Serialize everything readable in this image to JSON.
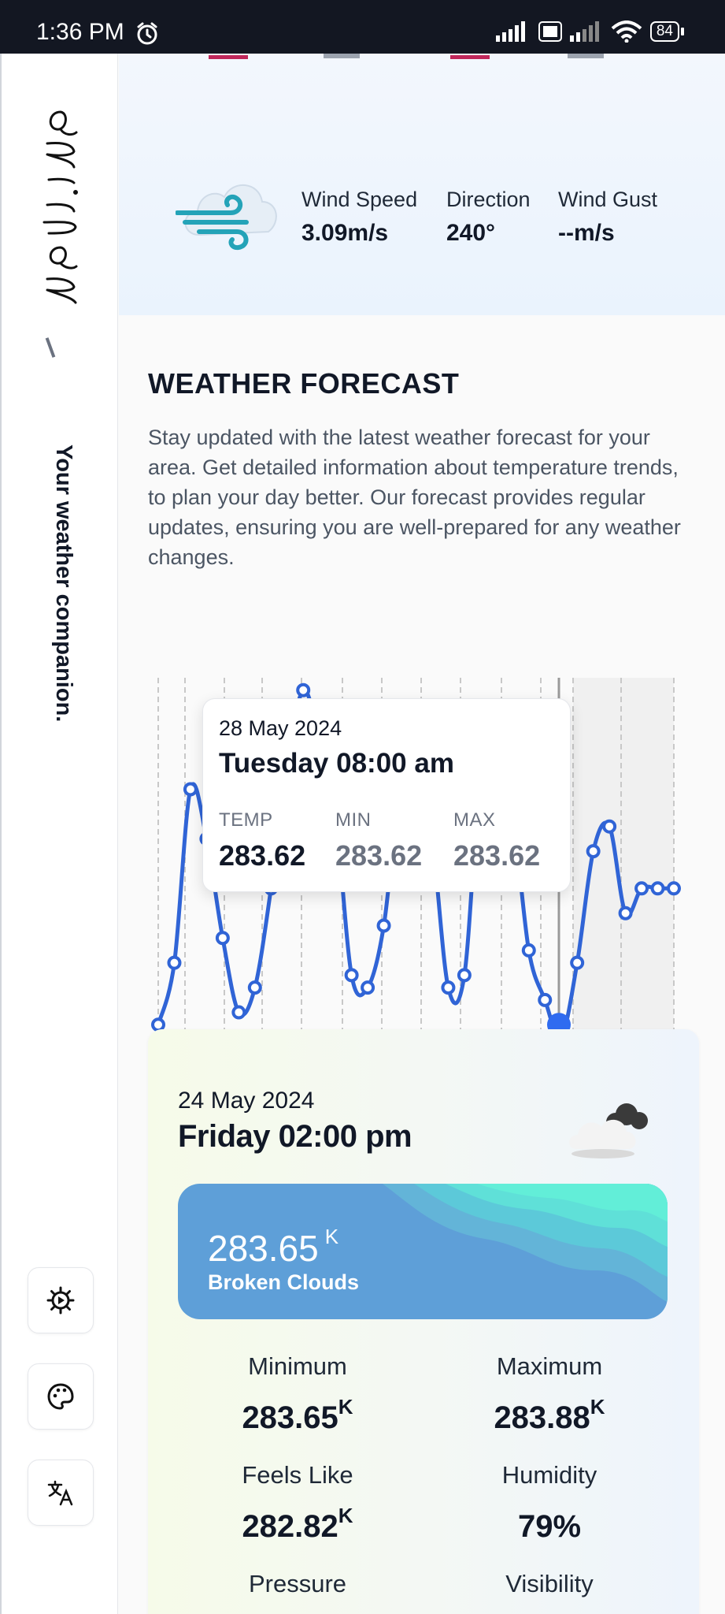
{
  "status_bar": {
    "time": "1:36 PM",
    "battery": "84"
  },
  "sidebar": {
    "tagline": "Your weather companion."
  },
  "wind": {
    "items": [
      {
        "label": "Wind Speed",
        "value": "3.09m/s"
      },
      {
        "label": "Direction",
        "value": "240°"
      },
      {
        "label": "Wind Gust",
        "value": "--m/s"
      }
    ]
  },
  "forecast": {
    "title": "WEATHER FORECAST",
    "description": "Stay updated with the latest weather forecast for your area. Get detailed information about temperature trends, to plan your day better. Our forecast provides regular updates, ensuring you are well-prepared for any weather changes."
  },
  "tooltip": {
    "date": "28 May 2024",
    "day_time": "Tuesday 08:00 am",
    "labels": {
      "temp": "TEMP",
      "min": "MIN",
      "max": "MAX"
    },
    "values": {
      "temp": "283.62",
      "min": "283.62",
      "max": "283.62"
    }
  },
  "chart_data": {
    "type": "line",
    "series": [
      {
        "values": [
          281.9,
          282.4,
          283.8,
          283.4,
          282.6,
          282.0,
          282.2,
          283.0,
          284.0,
          284.6,
          284.2,
          283.6,
          282.3,
          282.2,
          282.7,
          283.8,
          284.0,
          283.4,
          282.2,
          282.3,
          283.9,
          284.1,
          283.6,
          282.5,
          282.1,
          281.8,
          282.4,
          283.3,
          283.5,
          282.8,
          283.0,
          283.0,
          283.0
        ]
      }
    ],
    "highlight": {
      "value": 283.62
    },
    "line_color": "#3064d6",
    "grid": "vertical dashed",
    "ylim": [
      281.8,
      284.7
    ]
  },
  "current": {
    "date": "24 May 2024",
    "day_time": "Friday 02:00 pm",
    "temp": "283.65",
    "unit": "K",
    "condition": "Broken Clouds",
    "stats": [
      {
        "label": "Minimum",
        "value": "283.65",
        "unit": "K"
      },
      {
        "label": "Maximum",
        "value": "283.88",
        "unit": "K"
      },
      {
        "label": "Feels Like",
        "value": "282.82",
        "unit": "K"
      },
      {
        "label": "Humidity",
        "value": "79%",
        "unit": ""
      },
      {
        "label": "Pressure",
        "value": "",
        "unit": ""
      },
      {
        "label": "Visibility",
        "value": "",
        "unit": ""
      }
    ]
  },
  "colors": {
    "accent": "#3064d6",
    "banner": "#5e9fd8",
    "wave": "#5fe8d6"
  },
  "icons": [
    "alarm-icon",
    "signal-icon",
    "wifi-icon",
    "battery-icon",
    "wind-icon",
    "cloud-icon",
    "settings-icon",
    "palette-icon",
    "translate-icon"
  ]
}
